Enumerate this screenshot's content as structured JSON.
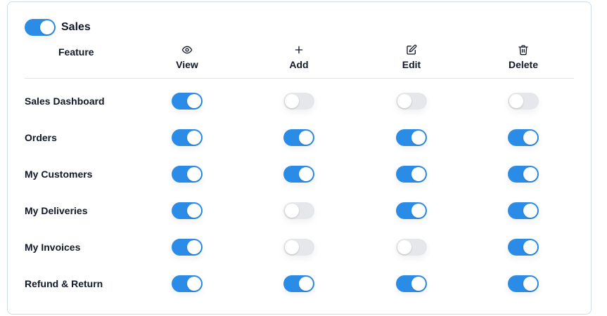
{
  "module": {
    "title": "Sales",
    "enabled": true
  },
  "columns": {
    "feature_label": "Feature",
    "view": {
      "label": "View",
      "icon": "eye-icon"
    },
    "add": {
      "label": "Add",
      "icon": "plus-icon"
    },
    "edit": {
      "label": "Edit",
      "icon": "edit-icon"
    },
    "delete": {
      "label": "Delete",
      "icon": "trash-icon"
    }
  },
  "rows": [
    {
      "name": "Sales Dashboard",
      "view": true,
      "add": false,
      "edit": false,
      "delete": false
    },
    {
      "name": "Orders",
      "view": true,
      "add": true,
      "edit": true,
      "delete": true
    },
    {
      "name": "My Customers",
      "view": true,
      "add": true,
      "edit": true,
      "delete": true
    },
    {
      "name": "My Deliveries",
      "view": true,
      "add": false,
      "edit": true,
      "delete": true
    },
    {
      "name": "My Invoices",
      "view": true,
      "add": false,
      "edit": false,
      "delete": true
    },
    {
      "name": "Refund & Return",
      "view": true,
      "add": true,
      "edit": true,
      "delete": true
    }
  ],
  "colors": {
    "toggle_on": "#2b8ce8",
    "toggle_off": "#e5e7eb",
    "card_border": "#cfdcea"
  }
}
